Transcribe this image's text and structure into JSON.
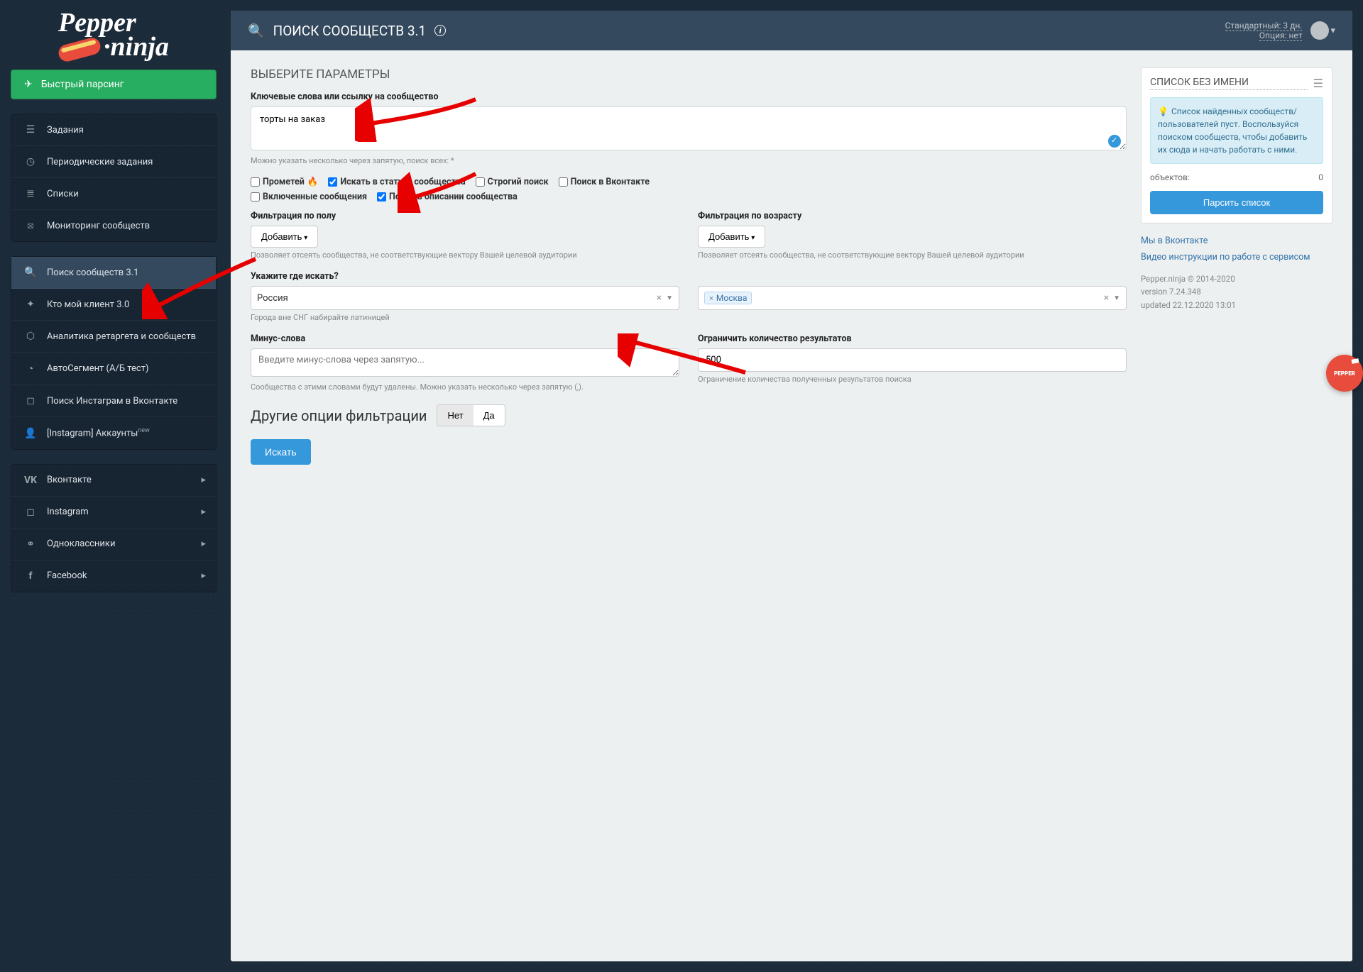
{
  "logo": {
    "line1": "Pepper",
    "line2": "·ninja"
  },
  "sidebar": {
    "fast_parsing": "Быстрый парсинг",
    "group1": [
      {
        "icon": "tasks",
        "label": "Задания"
      },
      {
        "icon": "clock",
        "label": "Периодические задания"
      },
      {
        "icon": "list",
        "label": "Списки"
      },
      {
        "icon": "binoculars",
        "label": "Мониторинг сообществ"
      }
    ],
    "group2": [
      {
        "icon": "search",
        "label": "Поиск сообществ 3.1",
        "active": true
      },
      {
        "icon": "wand",
        "label": "Кто мой клиент 3.0"
      },
      {
        "icon": "chart",
        "label": "Аналитика ретаргета и сообществ"
      },
      {
        "icon": "pie",
        "label": "АвтоСегмент (А/Б тест)"
      },
      {
        "icon": "instagram",
        "label": "Поиск Инстаграм в Вконтакте"
      },
      {
        "icon": "user",
        "label": "[Instagram] Аккаунты",
        "badge": "new"
      }
    ],
    "group3": [
      {
        "icon": "vk",
        "label": "Вконтакте"
      },
      {
        "icon": "instagram",
        "label": "Instagram"
      },
      {
        "icon": "ok",
        "label": "Одноклассники"
      },
      {
        "icon": "facebook",
        "label": "Facebook"
      }
    ]
  },
  "topbar": {
    "title": "ПОИСК СООБЩЕСТВ 3.1",
    "plan": "Стандартный: 3 дн.",
    "option": "Опция: нет"
  },
  "form": {
    "section_title": "ВЫБЕРИТЕ ПАРАМЕТРЫ",
    "keywords_label": "Ключевые слова или ссылку на сообщество",
    "keywords_value": "торты на заказ",
    "keywords_hint": "Можно указать несколько через запятую, поиск всех: *",
    "checks": {
      "prometheus": "Прометей",
      "status": "Искать в статусе сообщества",
      "strict": "Строгий поиск",
      "vk": "Поиск в Вконтакте",
      "enabled": "Включенные сообщения",
      "description": "Поиск в описании сообщества"
    },
    "gender": {
      "label": "Фильтрация по полу",
      "btn": "Добавить",
      "hint": "Позволяет отсеять сообщества, не соответствующие вектору Вашей целевой аудитории"
    },
    "age": {
      "label": "Фильтрация по возрасту",
      "btn": "Добавить",
      "hint": "Позволяет отсеять сообщества, не соответствующие вектору Вашей целевой аудитории"
    },
    "where": {
      "label": "Укажите где искать?",
      "country": "Россия",
      "city": "Москва",
      "hint": "Города вне СНГ набирайте латиницей"
    },
    "minus": {
      "label": "Минус-слова",
      "placeholder": "Введите минус-слова через запятую...",
      "hint": "Сообщества с этими словами будут удалены. Можно указать несколько через запятую (,)."
    },
    "limit": {
      "label": "Ограничить количество результатов",
      "value": "500",
      "hint": "Ограничение количества полученных результатов поиска"
    },
    "other_filters": "Другие опции фильтрации",
    "no": "Нет",
    "yes": "Да",
    "search_btn": "Искать"
  },
  "rightPanel": {
    "title": "СПИСОК БЕЗ ИМЕНИ",
    "info": "Список найденных сообществ/пользователей пуст. Воспользуйся поиском сообществ, чтобы добавить их сюда и начать работать с ними.",
    "objects_label": "объектов:",
    "objects_count": "0",
    "parse_btn": "Парсить список",
    "links": {
      "vk": "Мы в Вконтакте",
      "video": "Видео инструкции по работе с сервисом"
    },
    "meta": {
      "copyright": "Pepper.ninja © 2014-2020",
      "version": "version 7.24.348",
      "updated": "updated 22.12.2020 13:01"
    }
  },
  "badge": "PEPPER"
}
